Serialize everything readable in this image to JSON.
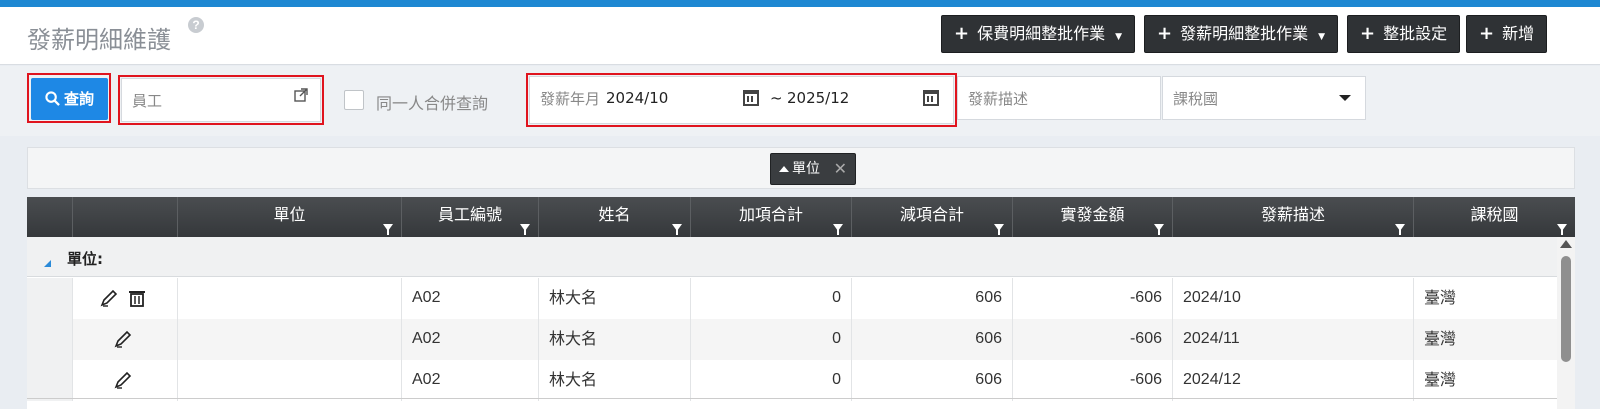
{
  "header": {
    "title": "發薪明細維護",
    "help": "?",
    "buttons": [
      {
        "label": "保費明細整批作業",
        "has_dropdown": true
      },
      {
        "label": "發薪明細整批作業",
        "has_dropdown": true
      },
      {
        "label": "整批設定",
        "has_dropdown": false
      },
      {
        "label": "新增",
        "has_dropdown": false
      }
    ]
  },
  "filters": {
    "query_label": "查詢",
    "employee_placeholder": "員工",
    "merge_label": "同一人合併查詢",
    "pay_month_label": "發薪年月",
    "pay_month_from": "2024/10",
    "range_sep": "~",
    "pay_month_to": "2025/12",
    "pay_desc_placeholder": "發薪描述",
    "tax_country_placeholder": "課稅國"
  },
  "grouping": {
    "chip_label": "單位"
  },
  "table": {
    "columns": [
      "單位",
      "員工編號",
      "姓名",
      "加項合計",
      "減項合計",
      "實發金額",
      "發薪描述",
      "課稅國"
    ],
    "group_label": "單位:",
    "rows": [
      {
        "unit": "",
        "emp_no": "A02",
        "name": "林大名",
        "add_total": "0",
        "deduct_total": "606",
        "net": "-606",
        "desc": "2024/10",
        "tax_country": "臺灣"
      },
      {
        "unit": "",
        "emp_no": "A02",
        "name": "林大名",
        "add_total": "0",
        "deduct_total": "606",
        "net": "-606",
        "desc": "2024/11",
        "tax_country": "臺灣"
      },
      {
        "unit": "",
        "emp_no": "A02",
        "name": "林大名",
        "add_total": "0",
        "deduct_total": "606",
        "net": "-606",
        "desc": "2024/12",
        "tax_country": "臺灣"
      }
    ]
  },
  "colors": {
    "accent": "#1e88e5",
    "header_dark": "#2f3235",
    "highlight": "#e0141e"
  }
}
